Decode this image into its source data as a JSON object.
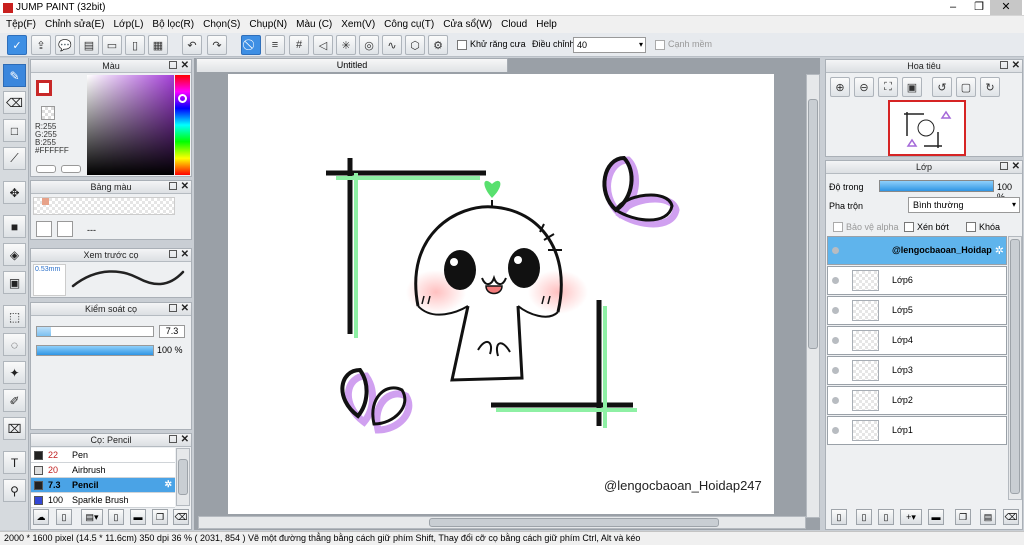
{
  "app": {
    "title": "JUMP PAINT (32bit)"
  },
  "menu": [
    "Tệp(F)",
    "Chỉnh sửa(E)",
    "Lớp(L)",
    "Bộ lọc(R)",
    "Chọn(S)",
    "Chụp(N)",
    "Màu (C)",
    "Xem(V)",
    "Công cụ(T)",
    "Cửa sổ(W)",
    "Cloud",
    "Help"
  ],
  "toolbar": {
    "antialias_label": "Khử răng cưa",
    "adjust_label": "Điều chỉnh",
    "adjust_value": "40",
    "snap_label": "Cạnh mềm"
  },
  "color_panel": {
    "title": "Màu",
    "r": "R:255",
    "g": "G:255",
    "b": "B:255",
    "hex": "#FFFFFF"
  },
  "swatch_panel": {
    "title": "Bảng màu",
    "dash": "---"
  },
  "brush_preview": {
    "title": "Xem trước cọ",
    "size": "0.53mm"
  },
  "brush_control": {
    "title": "Kiểm soát cọ",
    "size_value": "7.3",
    "opacity_value": "100 %"
  },
  "brush_list": {
    "title": "Cọ: Pencil",
    "items": [
      {
        "size": "22",
        "name": "Pen",
        "color": "#222222"
      },
      {
        "size": "20",
        "name": "Airbrush",
        "color": "#dddddd"
      },
      {
        "size": "7.3",
        "name": "Pencil",
        "color": "#222222"
      },
      {
        "size": "100",
        "name": "Sparkle Brush",
        "color": "#3347d6"
      }
    ]
  },
  "document": {
    "tab": "Untitled",
    "watermark": "@lengocbaoan_Hoidap247"
  },
  "navigator": {
    "title": "Hoa tiêu"
  },
  "layers": {
    "title": "Lớp",
    "opacity_label": "Độ trong",
    "opacity_value": "100 %",
    "blend_label": "Pha trộn",
    "blend_value": "Bình thường",
    "protect_alpha": "Bảo vệ alpha",
    "clip": "Xén bớt",
    "lock": "Khóa",
    "items": [
      "@lengocbaoan_Hoidap",
      "Lớp6",
      "Lớp5",
      "Lớp4",
      "Lớp3",
      "Lớp2",
      "Lớp1"
    ]
  },
  "status": {
    "text": "2000 * 1600 pixel   (14.5 * 11.6cm)   350 dpi   36 %   ( 2031, 854 )   Vẽ một đường thẳng bằng cách giữ phím Shift, Thay đổi cỡ cọ bằng cách giữ phím Ctrl, Alt và kéo"
  }
}
